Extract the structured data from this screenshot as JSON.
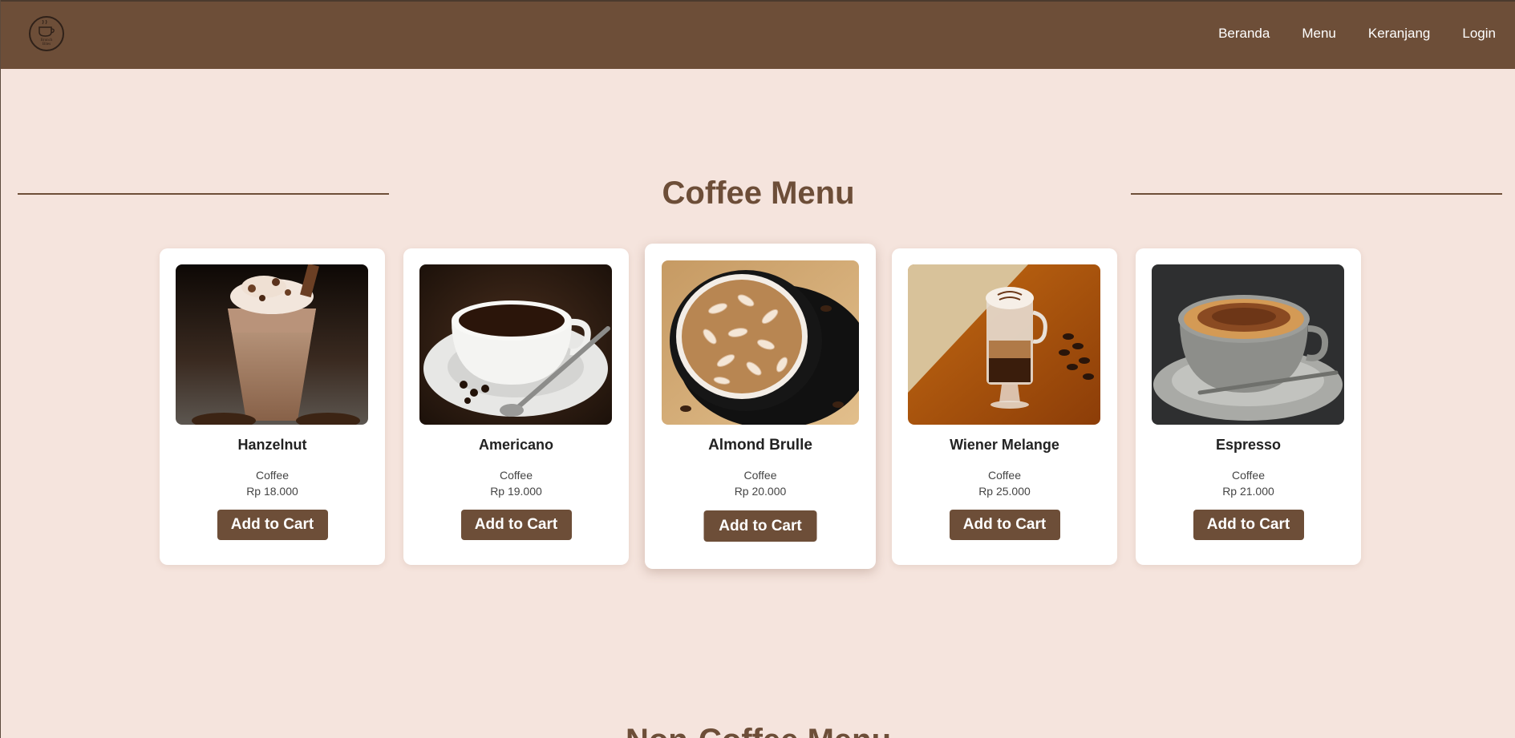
{
  "nav": {
    "logo_icon": "coffee-cup-logo-icon",
    "links": [
      "Beranda",
      "Menu",
      "Keranjang",
      "Login"
    ]
  },
  "coffee_section": {
    "title": "Coffee Menu"
  },
  "products": [
    {
      "name": "Hanzelnut",
      "category": "Coffee",
      "price": "Rp 18.000",
      "button": "Add to Cart",
      "image": "iced-hazelnut-frappe-image"
    },
    {
      "name": "Americano",
      "category": "Coffee",
      "price": "Rp 19.000",
      "button": "Add to Cart",
      "image": "black-coffee-cup-image"
    },
    {
      "name": "Almond Brulle",
      "category": "Coffee",
      "price": "Rp 20.000",
      "button": "Add to Cart",
      "image": "almond-topped-coffee-image"
    },
    {
      "name": "Wiener Melange",
      "category": "Coffee",
      "price": "Rp 25.000",
      "button": "Add to Cart",
      "image": "layered-latte-glass-image"
    },
    {
      "name": "Espresso",
      "category": "Coffee",
      "price": "Rp 21.000",
      "button": "Add to Cart",
      "image": "cappuccino-cup-image"
    }
  ],
  "next_section": {
    "title": "Non-Coffee Menu"
  },
  "colors": {
    "brand": "#6d4e38",
    "background": "#f5e4dd",
    "card": "#ffffff"
  }
}
